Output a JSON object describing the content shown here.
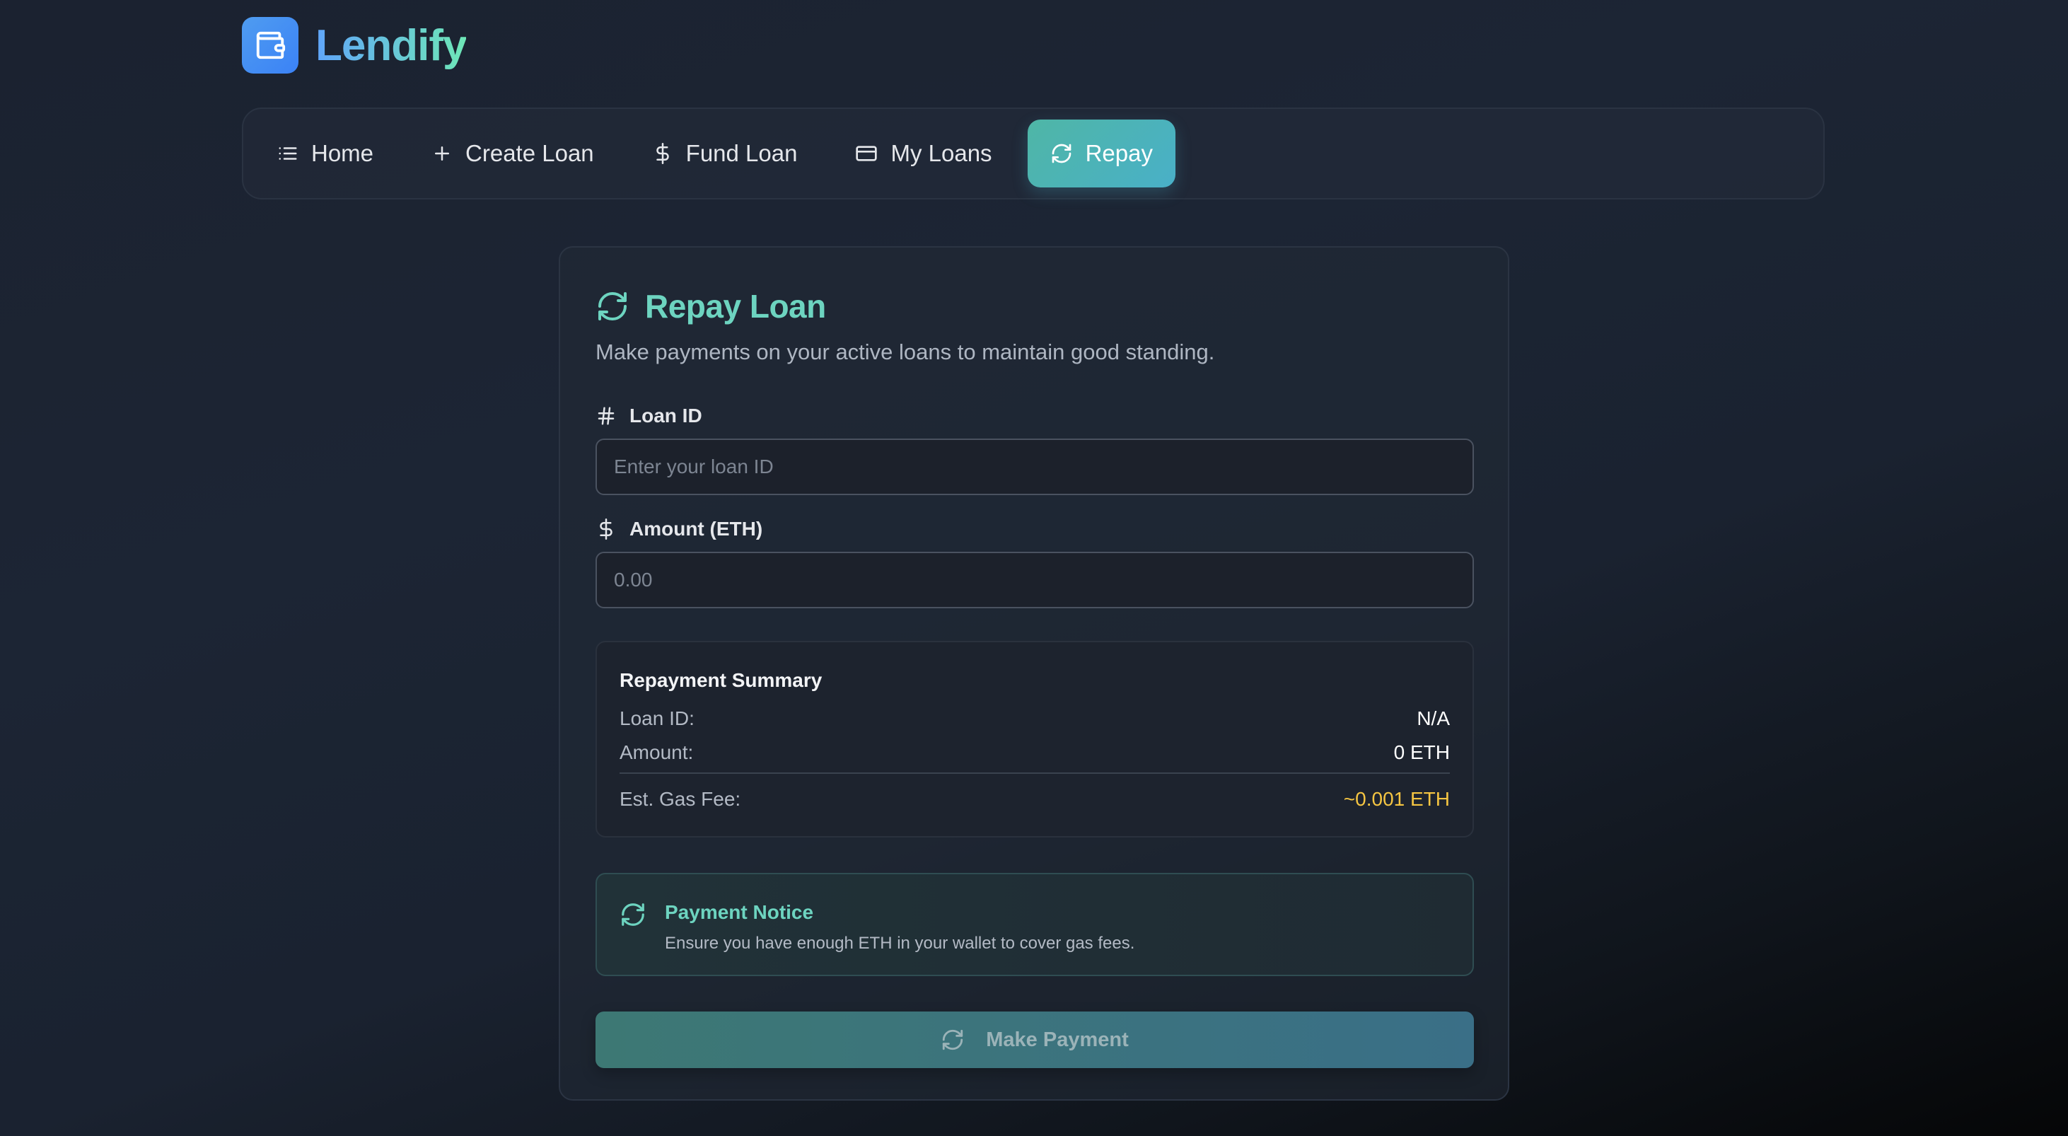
{
  "app": {
    "name": "Lendify",
    "icon": "wallet-icon",
    "colors": {
      "accent_teal": "#6dd4c0",
      "logo_blue": "#3b82f6",
      "warning_yellow": "#f5c542"
    }
  },
  "nav": {
    "items": [
      {
        "label": "Home",
        "icon": "list-icon"
      },
      {
        "label": "Create Loan",
        "icon": "plus-icon"
      },
      {
        "label": "Fund Loan",
        "icon": "dollar-icon"
      },
      {
        "label": "My Loans",
        "icon": "card-icon"
      },
      {
        "label": "Repay",
        "icon": "refresh-icon",
        "active": true
      }
    ]
  },
  "repay": {
    "title": "Repay Loan",
    "subtitle": "Make payments on your active loans to maintain good standing.",
    "loan_id": {
      "label": "Loan ID",
      "placeholder": "Enter your loan ID",
      "value": ""
    },
    "amount": {
      "label": "Amount (ETH)",
      "placeholder": "0.00",
      "value": ""
    },
    "summary": {
      "title": "Repayment Summary",
      "loan_id_label": "Loan ID:",
      "loan_id_value": "N/A",
      "amount_label": "Amount:",
      "amount_value": "0 ETH",
      "gas_label": "Est. Gas Fee:",
      "gas_value": "~0.001 ETH"
    },
    "notice": {
      "title": "Payment Notice",
      "text": "Ensure you have enough ETH in your wallet to cover gas fees."
    },
    "submit_label": "Make Payment"
  }
}
